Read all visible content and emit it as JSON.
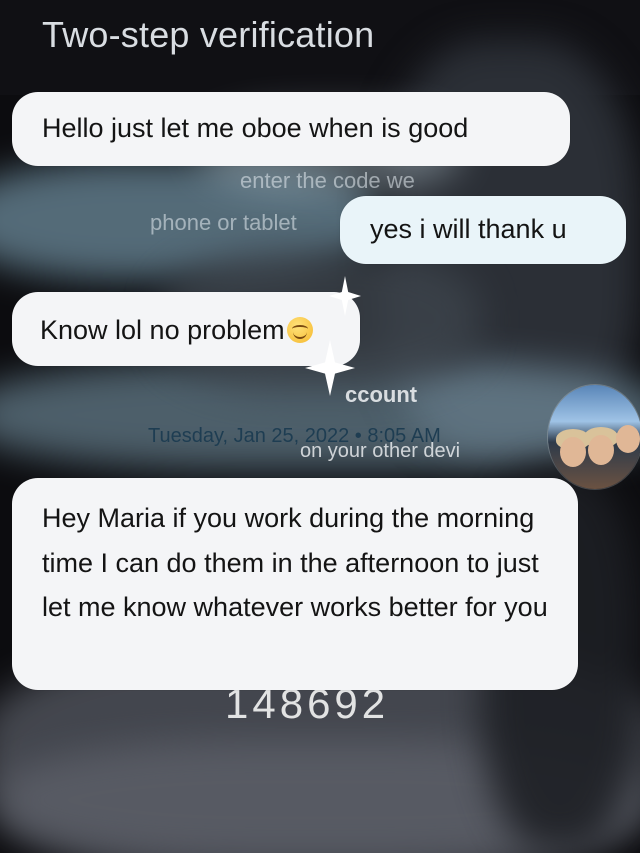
{
  "background_screen": {
    "title": "Two-step verification",
    "enter_code_text": "enter the code we",
    "phone_text": "phone or tablet",
    "account_text": "ccount",
    "other_device_text": "on your other devi",
    "code_text": "148692"
  },
  "messages": [
    {
      "id": "m1",
      "direction": "incoming",
      "text": "Hello just let me oboe when is good"
    },
    {
      "id": "m2",
      "direction": "outgoing",
      "text": "yes i will thank u"
    },
    {
      "id": "m3",
      "direction": "incoming",
      "text": "Know lol no problem",
      "emoji": "smiling-face-icon"
    },
    {
      "id": "m4",
      "direction": "incoming",
      "text": "Hey Maria if you work during the morning time I can do them in the afternoon to just let me know whatever works better for you"
    }
  ],
  "timestamp": "Tuesday, Jan 25, 2022 • 8:05 AM",
  "colors": {
    "bubble_incoming": "#f4f5f7",
    "bubble_outgoing": "#e9f4f9",
    "timestamp": "#1e3d52"
  }
}
